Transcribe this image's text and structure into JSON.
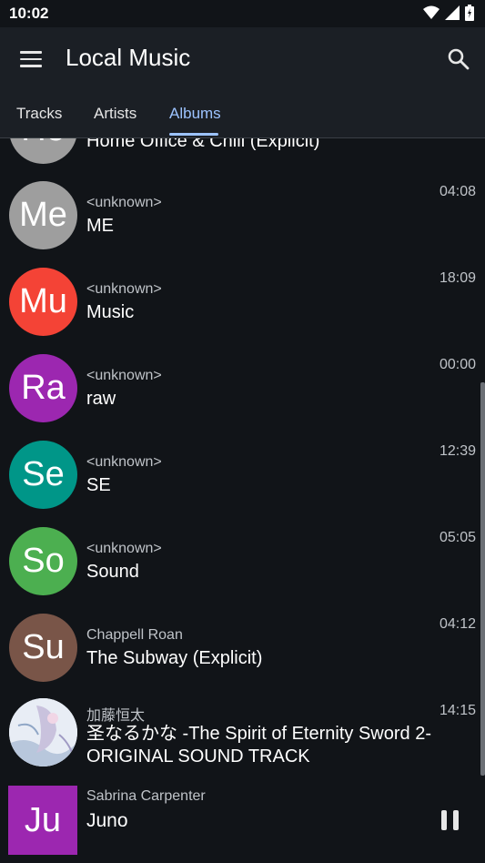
{
  "status_bar": {
    "time": "10:02",
    "icons": [
      "wifi-icon",
      "signal-icon",
      "battery-icon"
    ]
  },
  "app_bar": {
    "title": "Local Music",
    "menu_icon": "menu-icon",
    "search_icon": "search-icon"
  },
  "tabs": [
    {
      "label": "Tracks",
      "active": false
    },
    {
      "label": "Artists",
      "active": false
    },
    {
      "label": "Albums",
      "active": true
    }
  ],
  "albums": [
    {
      "avatar": "Ho",
      "color": "#9e9e9e",
      "artist": "",
      "title": "Home Office & Chill (Explicit)",
      "duration": ""
    },
    {
      "avatar": "Me",
      "color": "#9e9e9e",
      "artist": "<unknown>",
      "title": "ME",
      "duration": "04:08"
    },
    {
      "avatar": "Mu",
      "color": "#f44336",
      "artist": "<unknown>",
      "title": "Music",
      "duration": "18:09"
    },
    {
      "avatar": "Ra",
      "color": "#9c27b0",
      "artist": "<unknown>",
      "title": "raw",
      "duration": "00:00"
    },
    {
      "avatar": "Se",
      "color": "#009688",
      "artist": "<unknown>",
      "title": "SE",
      "duration": "12:39"
    },
    {
      "avatar": "So",
      "color": "#4caf50",
      "artist": "<unknown>",
      "title": "Sound",
      "duration": "05:05"
    },
    {
      "avatar": "Su",
      "color": "#795548",
      "artist": "Chappell Roan",
      "title": "The Subway (Explicit)",
      "duration": "04:12"
    },
    {
      "avatar": "",
      "color": "#cfd8e6",
      "artist": "加藤恒太",
      "title": "圣なるかな -The Spirit of Eternity Sword 2- ORIGINAL SOUND TRACK",
      "duration": "14:15"
    }
  ],
  "now_playing": {
    "art": "Ju",
    "art_color": "#9c27b0",
    "artist": "Sabrina Carpenter",
    "title": "Juno",
    "control_icon": "pause-icon"
  },
  "colors": {
    "background": "#111418",
    "app_bar": "#1b1f25",
    "accent": "#9cc3ff"
  }
}
